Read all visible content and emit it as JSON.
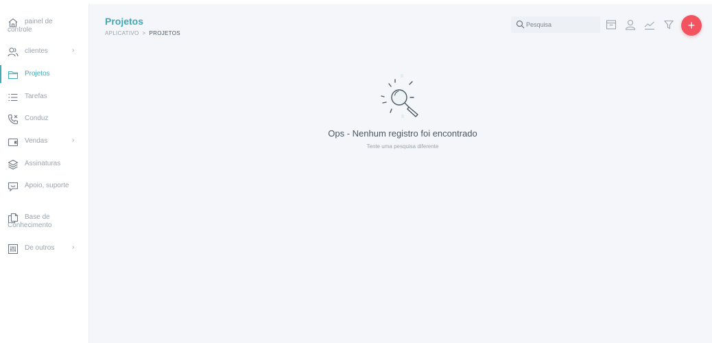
{
  "sidebar": {
    "items": [
      {
        "label": "painel de controle",
        "icon": "home-icon",
        "has_submenu": false
      },
      {
        "label": "clientes",
        "icon": "users-icon",
        "has_submenu": true
      },
      {
        "label": "Projetos",
        "icon": "folder-icon",
        "has_submenu": false,
        "active": true
      },
      {
        "label": "Tarefas",
        "icon": "list-icon",
        "has_submenu": false
      },
      {
        "label": "Conduz",
        "icon": "phone-icon",
        "has_submenu": false
      },
      {
        "label": "Vendas",
        "icon": "wallet-icon",
        "has_submenu": true
      },
      {
        "label": "Assinaturas",
        "icon": "layers-icon",
        "has_submenu": false
      },
      {
        "label": "Apoio, suporte",
        "icon": "chat-icon",
        "has_submenu": false
      },
      {
        "label": "Base de Conhecimento",
        "icon": "documents-icon",
        "has_submenu": false
      },
      {
        "label": "De outros",
        "icon": "sliders-icon",
        "has_submenu": true
      }
    ],
    "chevron": "›"
  },
  "header": {
    "title": "Projetos",
    "breadcrumb": {
      "root": "APLICATIVO",
      "separator": ">",
      "current": "PROJETOS"
    }
  },
  "toolbar": {
    "search_placeholder": "Pesquisa",
    "tools": [
      "archive-icon",
      "user-icon",
      "chart-icon",
      "filter-icon"
    ],
    "add_label": "+"
  },
  "empty_state": {
    "title": "Ops - Nenhum registro foi encontrado",
    "subtitle": "Tente uma pesquisa diferente"
  },
  "colors": {
    "accent": "#3fa9b5",
    "add_button": "#f2535f",
    "background": "#f4f6f9"
  }
}
